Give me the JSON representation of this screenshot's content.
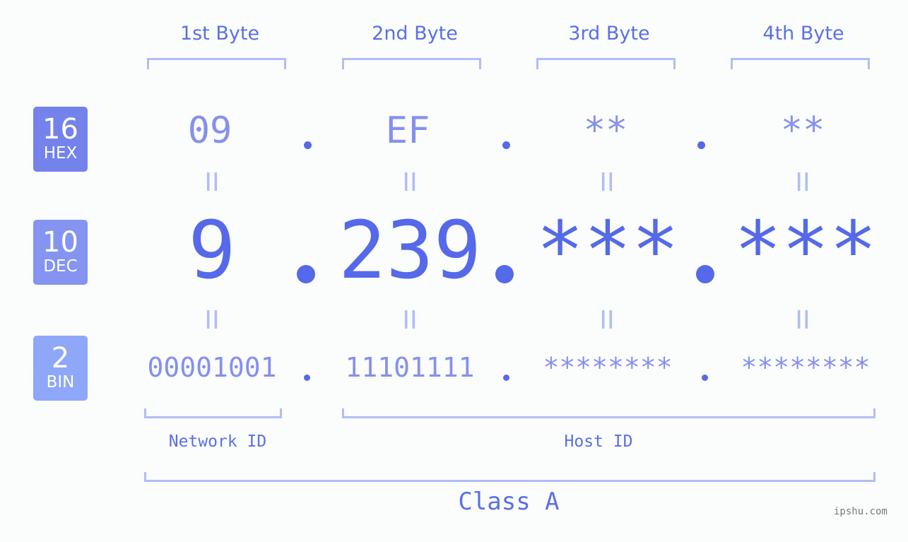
{
  "bytes": {
    "headers": [
      "1st Byte",
      "2nd Byte",
      "3rd Byte",
      "4th Byte"
    ]
  },
  "badges": {
    "hex": {
      "num": "16",
      "label": "HEX",
      "color": "#7482ec"
    },
    "dec": {
      "num": "10",
      "label": "DEC",
      "color": "#8494f0"
    },
    "bin": {
      "num": "2",
      "label": "BIN",
      "color": "#8fa7f8"
    }
  },
  "rows": {
    "hex": [
      "09",
      "EF",
      "**",
      "**"
    ],
    "dec": [
      "9",
      "239",
      "***",
      "***"
    ],
    "bin": [
      "00001001",
      "11101111",
      "********",
      "********"
    ]
  },
  "separator": ".",
  "equals": "II",
  "sections": {
    "network": "Network ID",
    "host": "Host ID",
    "class": "Class A"
  },
  "watermark": "ipshu.com",
  "colors": {
    "accent": "#5569ea",
    "light": "#8590ee",
    "bracket": "#b2bcf6"
  }
}
